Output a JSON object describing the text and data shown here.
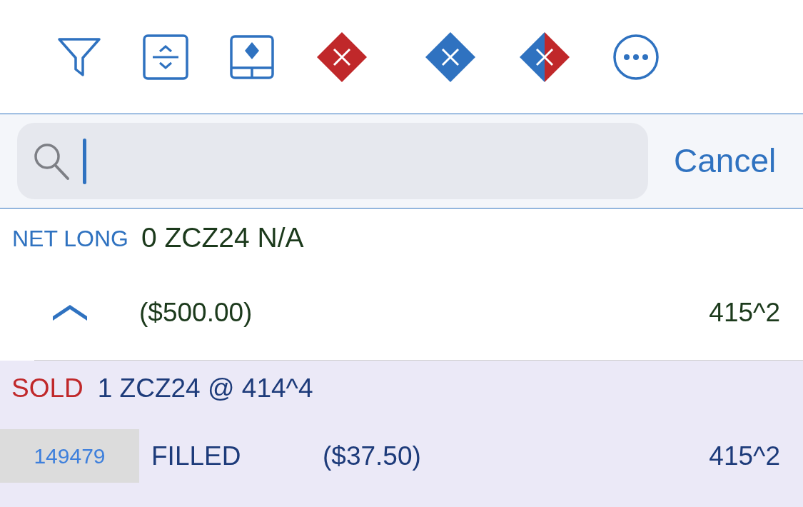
{
  "search": {
    "cancel_label": "Cancel",
    "focused": true
  },
  "position": {
    "side": "NET LONG",
    "summary": "0 ZCZ24 N/A",
    "expanded": true,
    "pnl": "($500.00)",
    "price": "415^2"
  },
  "order": {
    "side": "SOLD",
    "kind": "sell",
    "description": "1 ZCZ24 @ 414^4",
    "order_id": "149479",
    "status": "FILLED",
    "pnl": "($37.50)",
    "price": "415^2"
  }
}
